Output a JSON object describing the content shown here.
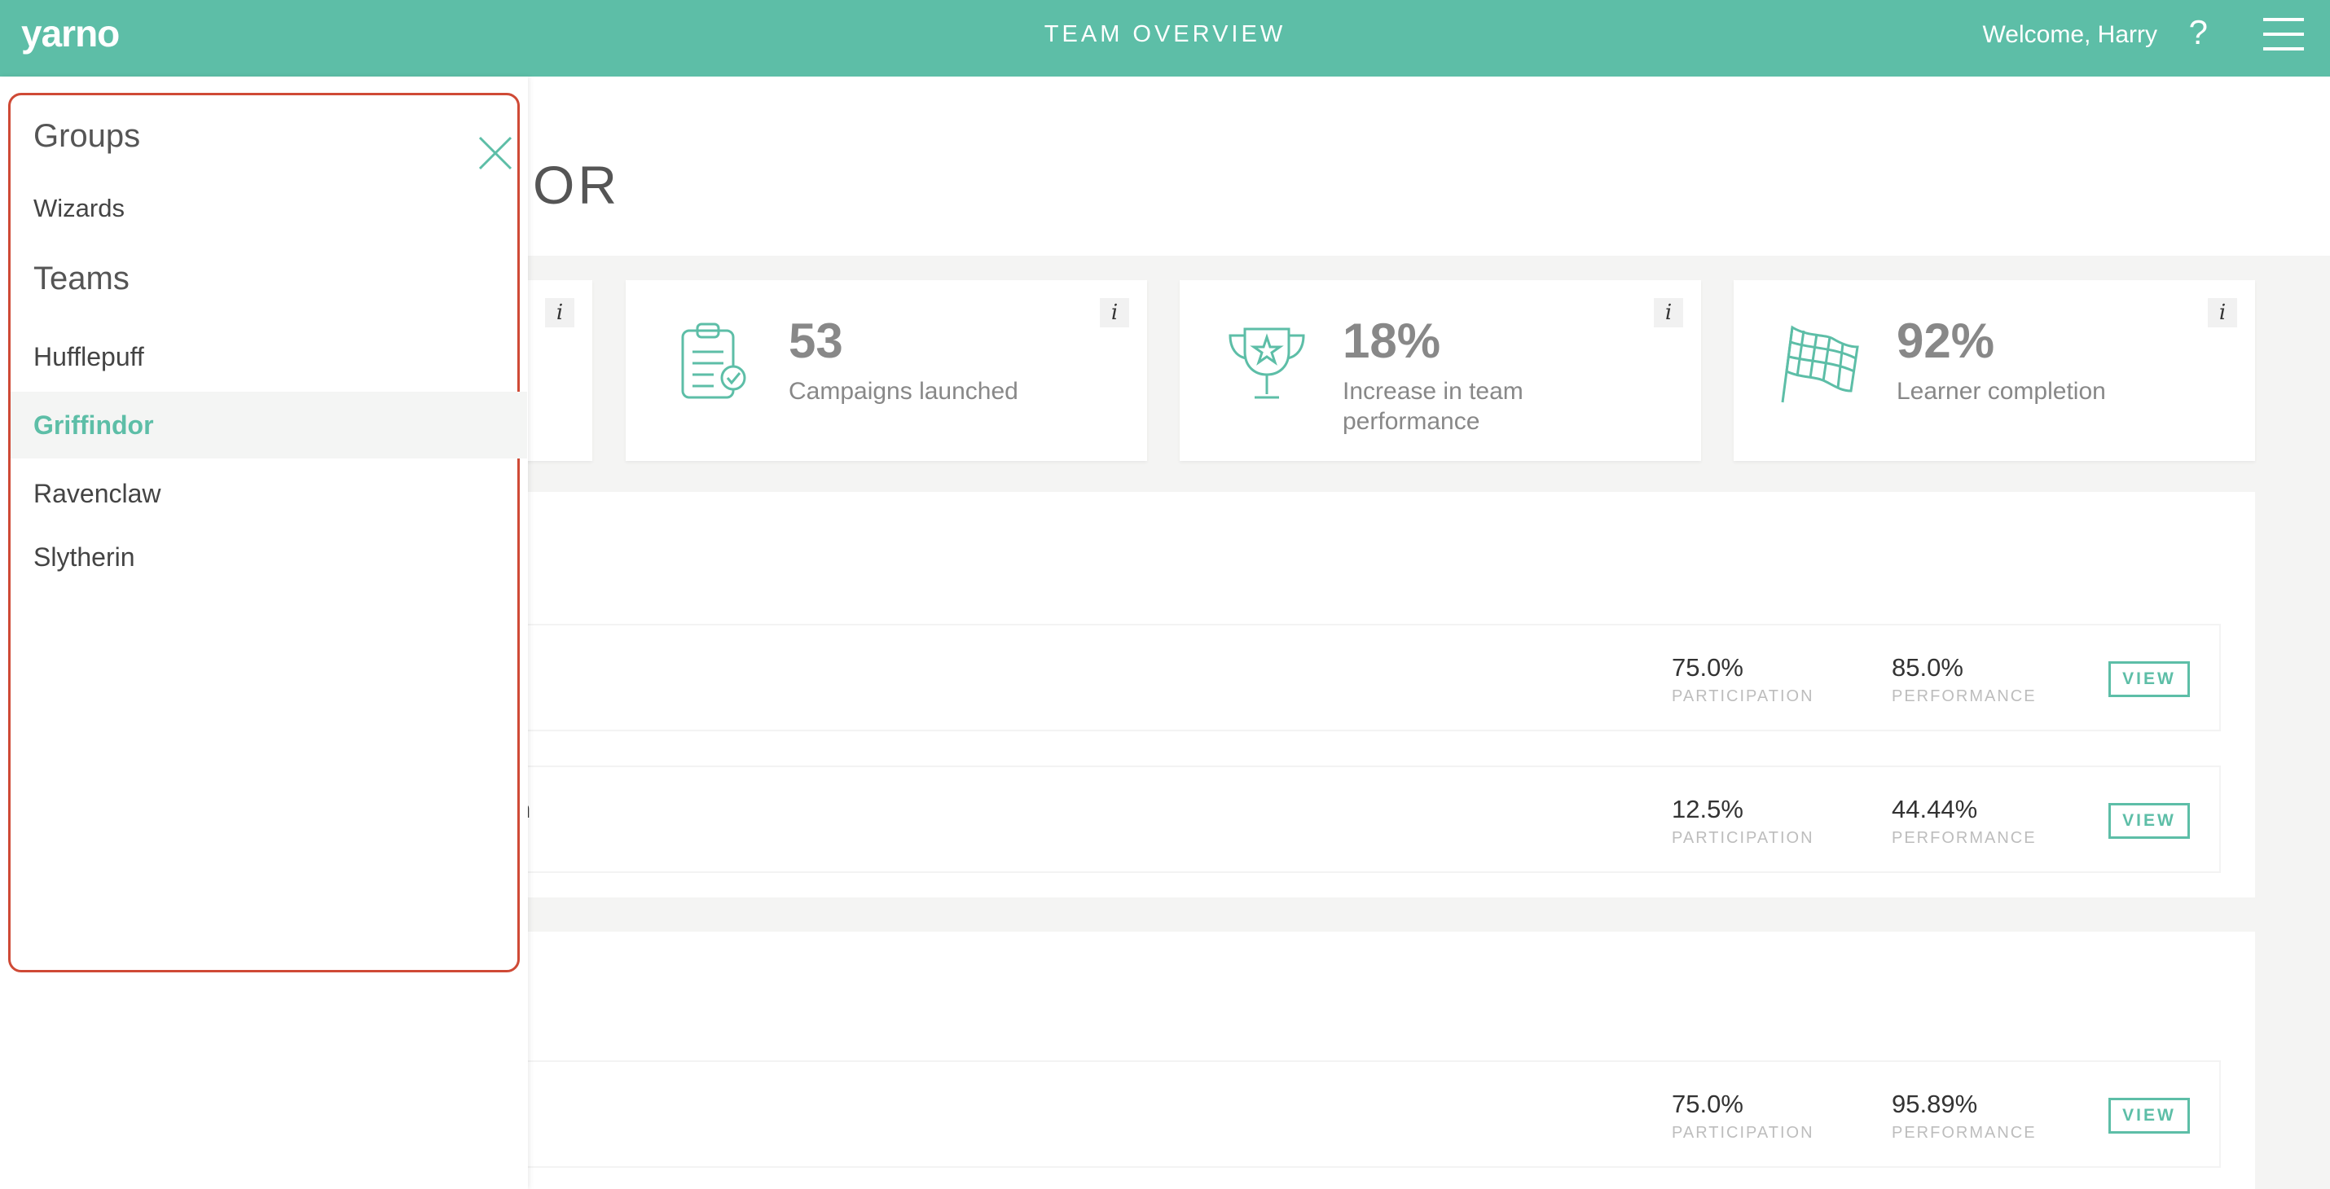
{
  "header": {
    "logo": "yarno",
    "title": "TEAM OVERVIEW",
    "welcome": "Welcome, Harry",
    "help": "?"
  },
  "page": {
    "title_visible": "OR"
  },
  "stats": [
    {
      "value": "53",
      "label": "Campaigns launched",
      "icon": "clipboard-check-icon"
    },
    {
      "value": "18%",
      "label": "Increase in team performance",
      "icon": "trophy-icon"
    },
    {
      "value": "92%",
      "label": "Learner completion",
      "icon": "checkered-flag-icon"
    }
  ],
  "info_label": "i",
  "rows": [
    {
      "partial_text": "",
      "participation": "75.0%",
      "performance": "85.0%"
    },
    {
      "partial_text": "n",
      "participation": "12.5%",
      "performance": "44.44%"
    },
    {
      "partial_text": "",
      "participation": "75.0%",
      "performance": "95.89%"
    }
  ],
  "metric_labels": {
    "participation": "PARTICIPATION",
    "performance": "PERFORMANCE"
  },
  "view_label": "VIEW",
  "sidebar": {
    "groups_title": "Groups",
    "groups": [
      "Wizards"
    ],
    "teams_title": "Teams",
    "teams": [
      "Hufflepuff",
      "Griffindor",
      "Ravenclaw",
      "Slytherin"
    ],
    "active_team": "Griffindor"
  },
  "colors": {
    "accent": "#5dbea7",
    "highlight_border": "#cf4a36"
  }
}
